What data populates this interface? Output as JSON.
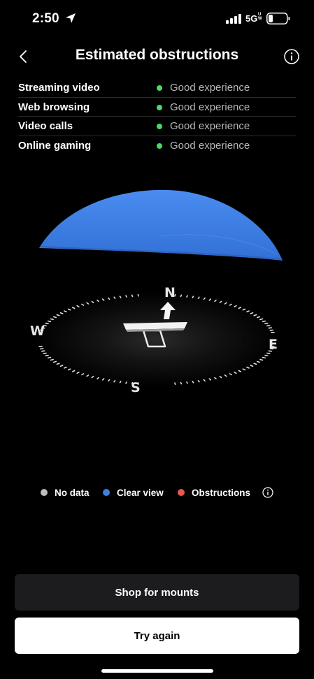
{
  "status_bar": {
    "time": "2:50",
    "network": "5G",
    "network_badge": "UW"
  },
  "header": {
    "title": "Estimated obstructions",
    "back_icon": "chevron-left-icon",
    "info_icon": "info-circle-icon"
  },
  "experiences": [
    {
      "name": "Streaming video",
      "status": "Good experience",
      "status_color": "#4cd964"
    },
    {
      "name": "Web browsing",
      "status": "Good experience",
      "status_color": "#4cd964"
    },
    {
      "name": "Video calls",
      "status": "Good experience",
      "status_color": "#4cd964"
    },
    {
      "name": "Online gaming",
      "status": "Good experience",
      "status_color": "#4cd964"
    }
  ],
  "compass": {
    "north": "N",
    "south": "S",
    "east": "E",
    "west": "W",
    "sky_color": "#3f7fe0"
  },
  "legend": [
    {
      "label": "No data",
      "color": "#bdbdbd"
    },
    {
      "label": "Clear view",
      "color": "#3f7fe0"
    },
    {
      "label": "Obstructions",
      "color": "#e8574a"
    }
  ],
  "buttons": {
    "shop": "Shop for mounts",
    "retry": "Try again"
  }
}
